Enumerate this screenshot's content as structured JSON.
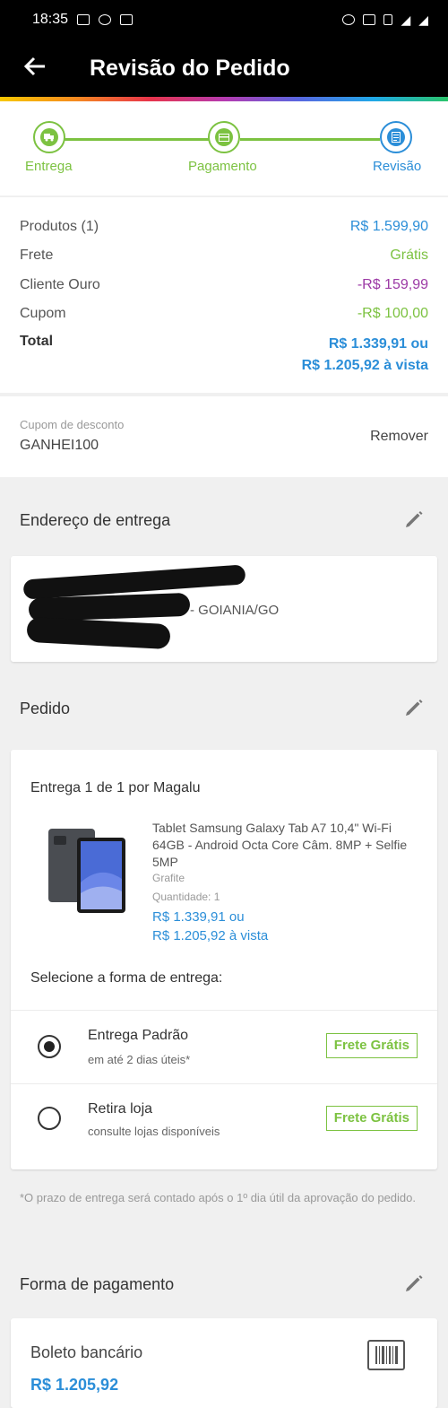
{
  "status_bar": {
    "time": "18:35"
  },
  "header": {
    "back_icon": "arrow-left-icon",
    "title": "Revisão do Pedido"
  },
  "stepper": {
    "steps": [
      {
        "label": "Entrega",
        "icon": "truck-icon",
        "state": "done"
      },
      {
        "label": "Pagamento",
        "icon": "card-icon",
        "state": "done"
      },
      {
        "label": "Revisão",
        "icon": "document-icon",
        "state": "active"
      }
    ],
    "colors": {
      "done": "#7cc241",
      "active": "#2b8ed8"
    }
  },
  "summary": {
    "produtos_label": "Produtos (1)",
    "produtos_value": "R$ 1.599,90",
    "frete_label": "Frete",
    "frete_value": "Grátis",
    "cliente_label": "Cliente Ouro",
    "cliente_value": "-R$ 159,99",
    "cupom_label": "Cupom",
    "cupom_value": "-R$ 100,00",
    "total_label": "Total",
    "total_value_1": "R$ 1.339,91 ou",
    "total_value_2": "R$ 1.205,92 à vista"
  },
  "coupon": {
    "label": "Cupom de desconto",
    "code": "GANHEI100",
    "remove_label": "Remover"
  },
  "address": {
    "section_title": "Endereço de entrega",
    "city": "- GOIANIA/GO"
  },
  "order": {
    "section_title": "Pedido",
    "delivery_title": "Entrega 1 de 1 por Magalu",
    "product_name": "Tablet Samsung Galaxy Tab A7 10,4\" Wi-Fi 64GB - Android Octa Core Câm. 8MP + Selfie 5MP",
    "product_color": "Grafite",
    "quantity": "Quantidade: 1",
    "price_1": "R$ 1.339,91 ou",
    "price_2": "R$ 1.205,92 à vista",
    "select_title": "Selecione a forma de entrega:",
    "options": [
      {
        "title": "Entrega Padrão",
        "subtitle": "em até 2 dias úteis*",
        "badge": "Frete Grátis",
        "selected": true
      },
      {
        "title": "Retira loja",
        "subtitle": "consulte lojas disponíveis",
        "badge": "Frete Grátis",
        "selected": false
      }
    ]
  },
  "note": "*O prazo de entrega será contado após o 1º dia útil da aprovação do pedido.",
  "payment": {
    "section_title": "Forma de pagamento",
    "method": "Boleto bancário",
    "value": "R$ 1.205,92"
  }
}
